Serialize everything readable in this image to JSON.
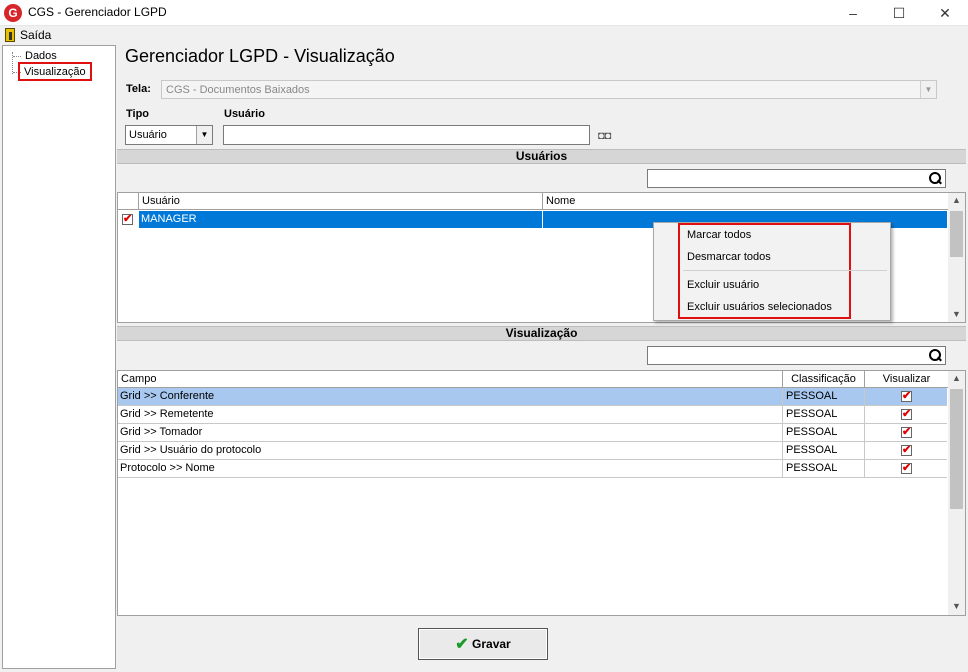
{
  "window": {
    "title": "CGS - Gerenciador LGPD",
    "logo_letter": "G",
    "minimize": "–",
    "maximize": "☐",
    "close": "✕"
  },
  "menu": {
    "exit_label": "Saída"
  },
  "tree": {
    "items": [
      "Dados",
      "Visualização"
    ]
  },
  "page": {
    "title": "Gerenciador LGPD - Visualização"
  },
  "filters": {
    "tela_label": "Tela:",
    "tela_value": "CGS - Documentos Baixados",
    "tipo_label": "Tipo",
    "tipo_value": "Usuário",
    "usuario_label": "Usuário",
    "usuario_value": ""
  },
  "users_section": {
    "title": "Usuários",
    "columns": [
      "Usuário",
      "Nome"
    ],
    "rows": [
      {
        "checked": true,
        "usuario": "MANAGER",
        "nome": ""
      }
    ]
  },
  "context_menu": {
    "items": [
      "Marcar todos",
      "Desmarcar todos",
      "Excluir usuário",
      "Excluir usuários selecionados"
    ]
  },
  "vis_section": {
    "title": "Visualização",
    "columns": [
      "Campo",
      "Classificação",
      "Visualizar"
    ],
    "rows": [
      {
        "campo": "Grid >> Conferente",
        "classificacao": "PESSOAL",
        "visualizar": true
      },
      {
        "campo": "Grid >> Remetente",
        "classificacao": "PESSOAL",
        "visualizar": true
      },
      {
        "campo": "Grid >> Tomador",
        "classificacao": "PESSOAL",
        "visualizar": true
      },
      {
        "campo": "Grid >> Usuário do protocolo",
        "classificacao": "PESSOAL",
        "visualizar": true
      },
      {
        "campo": "Protocolo >> Nome",
        "classificacao": "PESSOAL",
        "visualizar": true
      }
    ]
  },
  "footer": {
    "gravar_label": "Gravar"
  },
  "colors": {
    "selection": "#0078d7",
    "row_highlight": "#a8c8f0",
    "highlight_border": "#e01010",
    "check": "#e00000"
  }
}
